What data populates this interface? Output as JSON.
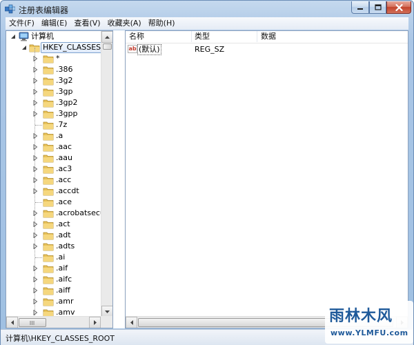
{
  "window": {
    "title": "注册表编辑器",
    "minimize_icon": "minimize-icon",
    "maximize_icon": "maximize-icon",
    "close_icon": "close-icon"
  },
  "menu": [
    "文件(F)",
    "编辑(E)",
    "查看(V)",
    "收藏夹(A)",
    "帮助(H)"
  ],
  "tree": {
    "root_label": "计算机",
    "hive_label": "HKEY_CLASSES_ROOT",
    "keys": [
      {
        "label": "*",
        "has_children": true
      },
      {
        "label": ".386",
        "has_children": true
      },
      {
        "label": ".3g2",
        "has_children": true
      },
      {
        "label": ".3gp",
        "has_children": true
      },
      {
        "label": ".3gp2",
        "has_children": true
      },
      {
        "label": ".3gpp",
        "has_children": true
      },
      {
        "label": ".7z",
        "has_children": false
      },
      {
        "label": ".a",
        "has_children": true
      },
      {
        "label": ".aac",
        "has_children": true
      },
      {
        "label": ".aau",
        "has_children": true
      },
      {
        "label": ".ac3",
        "has_children": true
      },
      {
        "label": ".acc",
        "has_children": true
      },
      {
        "label": ".accdt",
        "has_children": true
      },
      {
        "label": ".ace",
        "has_children": false
      },
      {
        "label": ".acrobatsecuritysettings",
        "has_children": true
      },
      {
        "label": ".act",
        "has_children": true
      },
      {
        "label": ".adt",
        "has_children": true
      },
      {
        "label": ".adts",
        "has_children": true
      },
      {
        "label": ".ai",
        "has_children": false
      },
      {
        "label": ".aif",
        "has_children": true
      },
      {
        "label": ".aifc",
        "has_children": true
      },
      {
        "label": ".aiff",
        "has_children": true
      },
      {
        "label": ".amr",
        "has_children": true
      },
      {
        "label": ".amv",
        "has_children": true
      }
    ]
  },
  "list": {
    "columns": [
      "名称",
      "类型",
      "数据"
    ],
    "rows": [
      {
        "name": "(默认)",
        "type": "REG_SZ",
        "data": "",
        "icon": "string-value-icon"
      }
    ]
  },
  "status": {
    "path": "计算机\\HKEY_CLASSES_ROOT"
  },
  "watermark": {
    "title": "雨林木风",
    "url": "www.YLMFU.com"
  },
  "colors": {
    "accent": "#1f5a9a",
    "folder": "#e8c25a",
    "selection_border": "#7da2ce"
  }
}
